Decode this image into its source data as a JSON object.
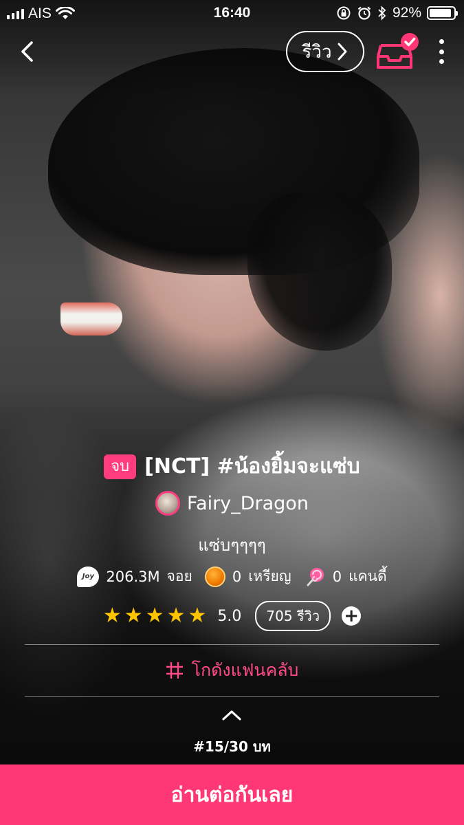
{
  "status_bar": {
    "carrier": "AIS",
    "time": "16:40",
    "battery": "92%",
    "battery_level": 0.92
  },
  "nav": {
    "review_label": "รีวิว",
    "back_icon": "chevron-left-icon",
    "inbox_icon": "inbox-check-icon",
    "more_icon": "more-vertical-icon"
  },
  "story": {
    "status_badge": "จบ",
    "title": "[NCT] #น้องยิ้มจะแซ่บ",
    "author": "Fairy_Dragon",
    "subtitle": "แซ่บๆๆๆๆ"
  },
  "stats": {
    "joy_value": "206.3M",
    "joy_label": "จอย",
    "coin_value": "0",
    "coin_label": "เหรียญ",
    "candy_value": "0",
    "candy_label": "แคนดี้"
  },
  "rating": {
    "stars": 5,
    "value": "5.0",
    "reviews": "705 รีวิว"
  },
  "fanclub": {
    "label": "โกดังแฟนคลับ"
  },
  "chapter": {
    "info": "#15/30 บท"
  },
  "cta": {
    "label": "อ่านต่อกันเลย"
  },
  "colors": {
    "accent": "#ff3776",
    "star": "#ffc400"
  }
}
